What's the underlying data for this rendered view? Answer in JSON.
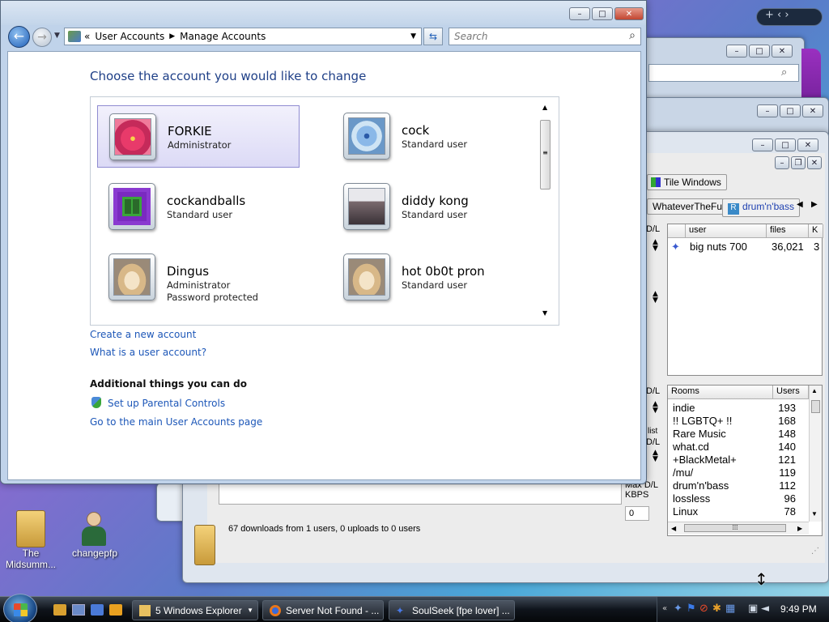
{
  "explorer": {
    "breadcrumb_prefix": "«",
    "breadcrumb": [
      "User Accounts",
      "Manage Accounts"
    ],
    "search_placeholder": "Search",
    "heading": "Choose the account you would like to change",
    "accounts": [
      {
        "name": "FORKIE",
        "type": "Administrator",
        "extra": "",
        "picture": "flower-picture",
        "selected": true
      },
      {
        "name": "cock",
        "type": "Standard user",
        "extra": "",
        "picture": "blue-flower-picture"
      },
      {
        "name": "cockandballs",
        "type": "Standard user",
        "extra": "",
        "picture": "window-picture"
      },
      {
        "name": "diddy kong",
        "type": "Standard user",
        "extra": "",
        "picture": "grass-picture"
      },
      {
        "name": "Dingus",
        "type": "Administrator",
        "extra": "Password protected",
        "picture": "dog-picture"
      },
      {
        "name": "hot 0b0t pron",
        "type": "Standard user",
        "extra": "",
        "picture": "dog-picture"
      }
    ],
    "links": {
      "create": "Create a new account",
      "what_is": "What is a user account?",
      "additional_heading": "Additional things you can do",
      "parental": "Set up Parental Controls",
      "main_page": "Go to the main User Accounts page"
    }
  },
  "soulseek": {
    "tile_windows": "Tile Windows",
    "tabs": [
      "WhateverTheFu",
      "drum'n'bass"
    ],
    "users_columns": [
      "user",
      "files",
      "K"
    ],
    "users": [
      {
        "user": "big nuts 700",
        "files": "36,021",
        "k": "3"
      }
    ],
    "rooms_columns": [
      "Rooms",
      "Users"
    ],
    "rooms": [
      {
        "name": "indie",
        "users": "193"
      },
      {
        "name": "!! LGBTQ+ !!",
        "users": "168"
      },
      {
        "name": "Rare Music",
        "users": "148"
      },
      {
        "name": "what.cd",
        "users": "140"
      },
      {
        "name": "+BlackMetal+",
        "users": "121"
      },
      {
        "name": "/mu/",
        "users": "119"
      },
      {
        "name": "drum'n'bass",
        "users": "112"
      },
      {
        "name": "lossless",
        "users": "96"
      },
      {
        "name": "Linux",
        "users": "78"
      }
    ],
    "status": "67 downloads from 1 users, 0 uploads to 0 users",
    "kbps_label": "KBPS",
    "kbps_value": "0",
    "side_labels": [
      "D/L",
      "D/L",
      "list",
      "D/L",
      "Max D/L"
    ]
  },
  "desktop": {
    "icons": [
      {
        "label": "The Midsumm...",
        "icon": "folder-icon"
      },
      {
        "label": "changepfp",
        "icon": "user-icon"
      }
    ]
  },
  "taskbar": {
    "items": [
      {
        "label": "5 Windows Explorer",
        "icon": "folder-icon"
      },
      {
        "label": "Server Not Found - ...",
        "icon": "firefox-icon"
      },
      {
        "label": "SoulSeek [fpe lover] ...",
        "icon": "soulseek-icon"
      }
    ],
    "clock": "9:49 PM"
  }
}
